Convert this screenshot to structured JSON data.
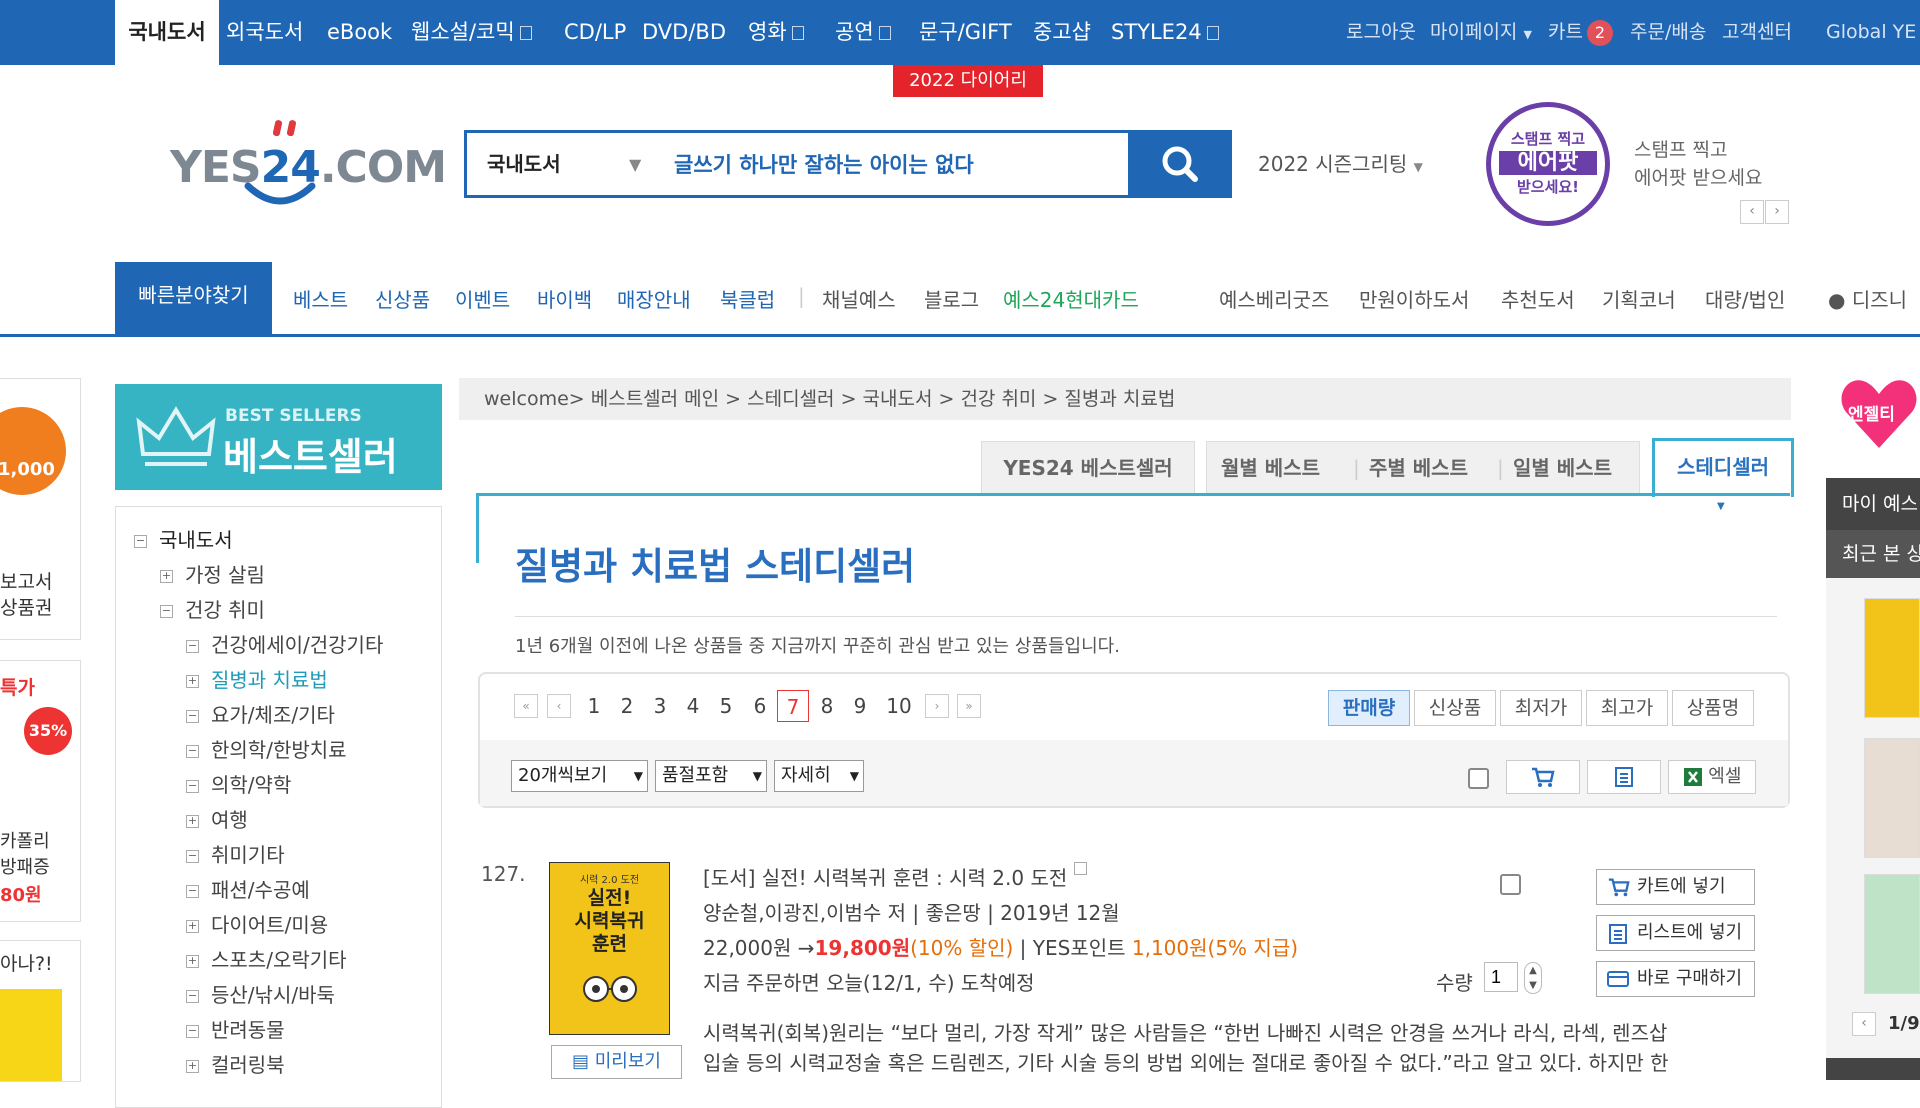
{
  "topnav": {
    "categories": [
      "국내도서",
      "외국도서",
      "eBook",
      "웹소설/코믹",
      "CD/LP",
      "DVD/BD",
      "영화",
      "공연",
      "문구/GIFT",
      "중고샵",
      "STYLE24"
    ],
    "right": {
      "logout": "로그아웃",
      "mypage": "마이페이지",
      "cart": "카트",
      "cart_count": "2",
      "orders": "주문/배송",
      "service": "고객센터",
      "global": "Global YE"
    },
    "promo_tag": "2022 다이어리"
  },
  "logo": {
    "text_left": "YES",
    "text_num": "24",
    "text_right": ".COM"
  },
  "search": {
    "category": "국내도서",
    "value": "글쓰기 하나만 잘하는 아이는 없다"
  },
  "season": "2022 시즌그리팅",
  "stamp": {
    "badge_lines": [
      "스탬프 찍고",
      "에어팟",
      "받으세요!"
    ],
    "line1": "스탬프 찍고",
    "line2": "에어팟 받으세요"
  },
  "subnav": {
    "quick": "빠른분야찾기",
    "left": [
      "베스트",
      "신상품",
      "이벤트",
      "바이백",
      "매장안내",
      "북클럽"
    ],
    "mid": [
      "채널예스",
      "블로그"
    ],
    "card": "예스24현대카드",
    "right": [
      "예스베리굿즈",
      "만원이하도서",
      "추천도서",
      "기획코너",
      "대량/법인",
      "디즈니"
    ]
  },
  "left_edge": {
    "line1": "보고서",
    "line2": "상품권",
    "price": "1,000",
    "sale": "특가",
    "percent": "35%",
    "promo1": "카폴리",
    "promo2": "방패증",
    "promo_price": "80원",
    "ask": "아나?!"
  },
  "bestseller": {
    "sub": "BEST SELLERS",
    "title": "베스트셀러"
  },
  "tree": [
    {
      "label": "국내도서",
      "level": 0,
      "toggle": "−"
    },
    {
      "label": "가정 살림",
      "level": 1,
      "toggle": "+"
    },
    {
      "label": "건강 취미",
      "level": 1,
      "toggle": "−"
    },
    {
      "label": "건강에세이/건강기타",
      "level": 2,
      "toggle": "−"
    },
    {
      "label": "질병과 치료법",
      "level": 2,
      "toggle": "+",
      "active": true
    },
    {
      "label": "요가/체조/기타",
      "level": 2,
      "toggle": "−"
    },
    {
      "label": "한의학/한방치료",
      "level": 2,
      "toggle": "−"
    },
    {
      "label": "의학/약학",
      "level": 2,
      "toggle": "−"
    },
    {
      "label": "여행",
      "level": 2,
      "toggle": "+"
    },
    {
      "label": "취미기타",
      "level": 2,
      "toggle": "−"
    },
    {
      "label": "패션/수공예",
      "level": 2,
      "toggle": "−"
    },
    {
      "label": "다이어트/미용",
      "level": 2,
      "toggle": "+"
    },
    {
      "label": "스포츠/오락기타",
      "level": 2,
      "toggle": "+"
    },
    {
      "label": "등산/낚시/바둑",
      "level": 2,
      "toggle": "−"
    },
    {
      "label": "반려동물",
      "level": 2,
      "toggle": "−"
    },
    {
      "label": "컬러링북",
      "level": 2,
      "toggle": "+"
    }
  ],
  "breadcrumb": "welcome> 베스트셀러 메인 > 스테디셀러 > 국내도서 > 건강 취미 > 질병과 치료법",
  "tabs": {
    "yes24": "YES24 베스트셀러",
    "monthly": "월별 베스트",
    "weekly": "주별 베스트",
    "daily": "일별 베스트",
    "steady": "스테디셀러"
  },
  "list": {
    "title": "질병과 치료법 스테디셀러",
    "desc": "1년 6개월 이전에 나온 상품들 중 지금까지 꾸준히 관심 받고 있는 상품들입니다.",
    "pages": [
      "1",
      "2",
      "3",
      "4",
      "5",
      "6",
      "7",
      "8",
      "9",
      "10"
    ],
    "current_page": "7",
    "sort": [
      "판매량",
      "신상품",
      "최저가",
      "최고가",
      "상품명"
    ],
    "per_page": "20개씩보기",
    "stock": "품절포함",
    "view": "자세히",
    "excel": "엑셀"
  },
  "product": {
    "rank": "127.",
    "cover_lines": [
      "실전!",
      "시력복귀",
      "훈련"
    ],
    "cover_top": "시력 2.0 도전",
    "title": "[도서] 실전! 시력복귀 훈련 : 시력 2.0 도전",
    "meta": "양순철,이광진,이범수 저 | 좋은땅 | 2019년 12월",
    "price_orig": "22,000원",
    "arrow": " →",
    "price_sale": "19,800원",
    "discount": "(10% 할인)",
    "points_label": " | YES포인트 ",
    "points": "1,100원",
    "points_rate": "(5% 지급)",
    "delivery": "지금 주문하면 오늘(12/1, 수) 도착예정",
    "qty_label": "수량",
    "qty": "1",
    "preview": "미리보기",
    "cart_btn": "카트에 넣기",
    "list_btn": "리스트에 넣기",
    "buy_btn": "바로 구매하기",
    "desc1": "시력복귀(회복)원리는 “보다 멀리, 가장 작게” 많은 사람들은 “한번 나빠진 시력은 안경을 쓰거나 라식, 라섹, 렌즈삽",
    "desc2": "입술 등의 시력교정술 혹은 드림렌즈, 기타 시술 등의 방법 외에는 절대로 좋아질 수 없다.”라고 알고 있다. 하지만 한"
  },
  "right_side": {
    "heart": "엔젤티",
    "mine": "마이 예스",
    "recent": "최근 본 상",
    "pager": "1/9"
  },
  "colors": {
    "brand": "#1f66b5",
    "accent": "#3aaed0",
    "sale": "#e33"
  }
}
